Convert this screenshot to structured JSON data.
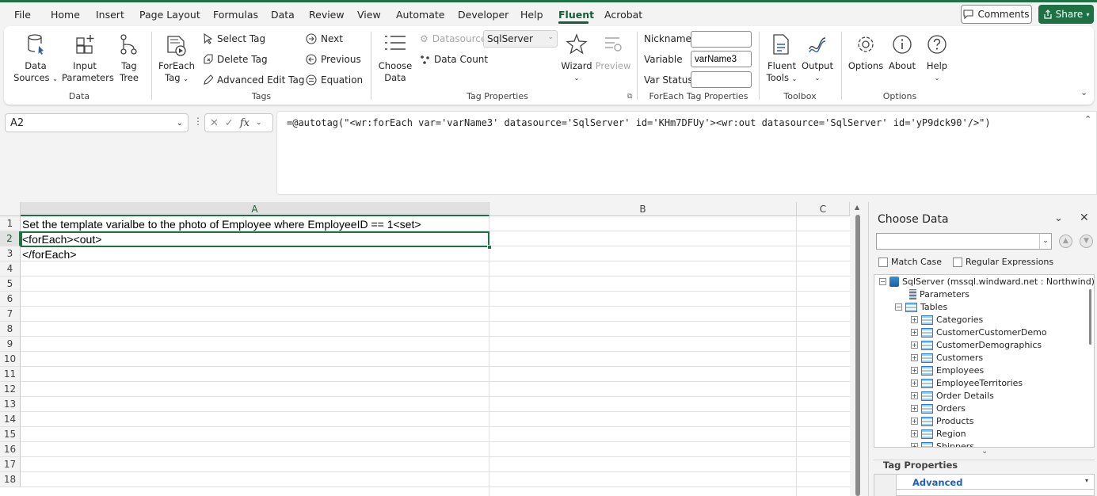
{
  "tabs": [
    "File",
    "Home",
    "Insert",
    "Page Layout",
    "Formulas",
    "Data",
    "Review",
    "View",
    "Automate",
    "Developer",
    "Help",
    "Fluent",
    "Acrobat"
  ],
  "active_tab": "Fluent",
  "header": {
    "comments_label": "Comments",
    "share_label": "Share"
  },
  "ribbon": {
    "data_group": {
      "label": "Data",
      "data_sources": [
        "Data",
        "Sources"
      ],
      "input_parameters": [
        "Input",
        "Parameters"
      ],
      "tag_tree": [
        "Tag",
        "Tree"
      ]
    },
    "tags_group": {
      "label": "Tags",
      "foreach_tag": [
        "ForEach",
        "Tag"
      ],
      "select_tag": "Select Tag",
      "delete_tag": "Delete Tag",
      "advanced_edit_tag": "Advanced Edit Tag",
      "next": "Next",
      "previous": "Previous",
      "equation": "Equation"
    },
    "tag_properties_group": {
      "label": "Tag Properties",
      "choose_data": [
        "Choose",
        "Data"
      ],
      "datasource_label": "Datasource",
      "datasource_value": "SqlServer",
      "data_count": "Data Count",
      "wizard": "Wizard",
      "preview": "Preview"
    },
    "foreach_props_group": {
      "label": "ForEach Tag Properties",
      "nickname_label": "Nickname",
      "nickname_value": "",
      "variable_label": "Variable",
      "variable_value": "varName3",
      "var_status_label": "Var Status",
      "var_status_value": ""
    },
    "toolbox_group": {
      "label": "Toolbox",
      "fluent_tools": [
        "Fluent",
        "Tools"
      ],
      "output": "Output"
    },
    "options_group": {
      "label": "Options",
      "options": "Options",
      "about": "About",
      "help": "Help"
    }
  },
  "formula_bar": {
    "name_box": "A2",
    "formula": "=@autotag(\"<wr:forEach var='varName3' datasource='SqlServer' id='KHm7DFUy'><wr:out datasource='SqlServer' id='yP9dck90'/>\")"
  },
  "sheet": {
    "columns": [
      "A",
      "B",
      "C"
    ],
    "rows": [
      "1",
      "2",
      "3",
      "4",
      "5",
      "6",
      "7",
      "8",
      "9",
      "10",
      "11",
      "12",
      "13",
      "14",
      "15",
      "16",
      "17",
      "18"
    ],
    "cells": {
      "A1": "Set the template varialbe to the photo of Employee where EmployeeID == 1<set>",
      "A2": "<forEach><out>",
      "A3": "</forEach>"
    }
  },
  "panel": {
    "title": "Choose Data",
    "search_value": "",
    "match_case": "Match Case",
    "regular_expressions": "Regular Expressions",
    "tree_root": "SqlServer (mssql.windward.net : Northwind)",
    "parameters": "Parameters",
    "tables": "Tables",
    "table_items": [
      "Categories",
      "CustomerCustomerDemo",
      "CustomerDemographics",
      "Customers",
      "Employees",
      "EmployeeTerritories",
      "Order Details",
      "Orders",
      "Products",
      "Region",
      "Shippers"
    ],
    "tag_properties_title": "Tag Properties",
    "advanced_label": "Advanced"
  }
}
